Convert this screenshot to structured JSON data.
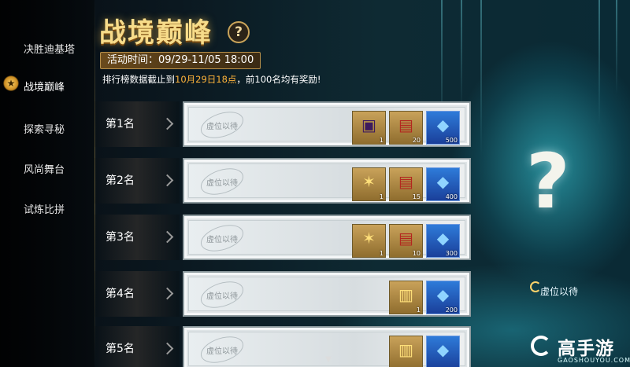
{
  "sidebar": {
    "items": [
      {
        "label": "决胜迪基塔"
      },
      {
        "label": "战境巅峰"
      },
      {
        "label": "探索寻秘"
      },
      {
        "label": "风尚舞台"
      },
      {
        "label": "试炼比拼"
      }
    ]
  },
  "header": {
    "title": "战境巅峰",
    "help": "?",
    "period": "活动时间：09/29-11/05 18:00",
    "notice_prefix": "排行榜数据截止到",
    "notice_highlight": "10月29日18点",
    "notice_suffix": "，前100名均有奖励!"
  },
  "ranks": [
    {
      "label": "第1名",
      "placeholder": "虚位以待",
      "rewards": [
        {
          "icon": "purple-chest-icon",
          "count": "1"
        },
        {
          "icon": "gold-crate-icon",
          "count": "20"
        },
        {
          "icon": "blue-gem-icon",
          "count": "500"
        }
      ]
    },
    {
      "label": "第2名",
      "placeholder": "虚位以待",
      "rewards": [
        {
          "icon": "gold-wings-icon",
          "count": "1"
        },
        {
          "icon": "gold-crate-icon",
          "count": "15"
        },
        {
          "icon": "blue-gem-icon",
          "count": "400"
        }
      ]
    },
    {
      "label": "第3名",
      "placeholder": "虚位以待",
      "rewards": [
        {
          "icon": "gold-wings-icon",
          "count": "1"
        },
        {
          "icon": "gold-crate-icon",
          "count": "10"
        },
        {
          "icon": "blue-gem-icon",
          "count": "300"
        }
      ]
    },
    {
      "label": "第4名",
      "placeholder": "虚位以待",
      "rewards": [
        {
          "icon": "treasure-chest-icon",
          "count": "1"
        },
        {
          "icon": "blue-gem-icon",
          "count": "200"
        }
      ]
    },
    {
      "label": "第5名",
      "placeholder": "虚位以待",
      "rewards": [
        {
          "icon": "treasure-chest-icon",
          "count": ""
        },
        {
          "icon": "blue-gem-icon",
          "count": ""
        }
      ]
    }
  ],
  "showcase": {
    "question": "?",
    "caption": "虚位以待"
  },
  "watermark": {
    "brand": "高手游",
    "url": "GAOSHOUYOU.COM"
  }
}
